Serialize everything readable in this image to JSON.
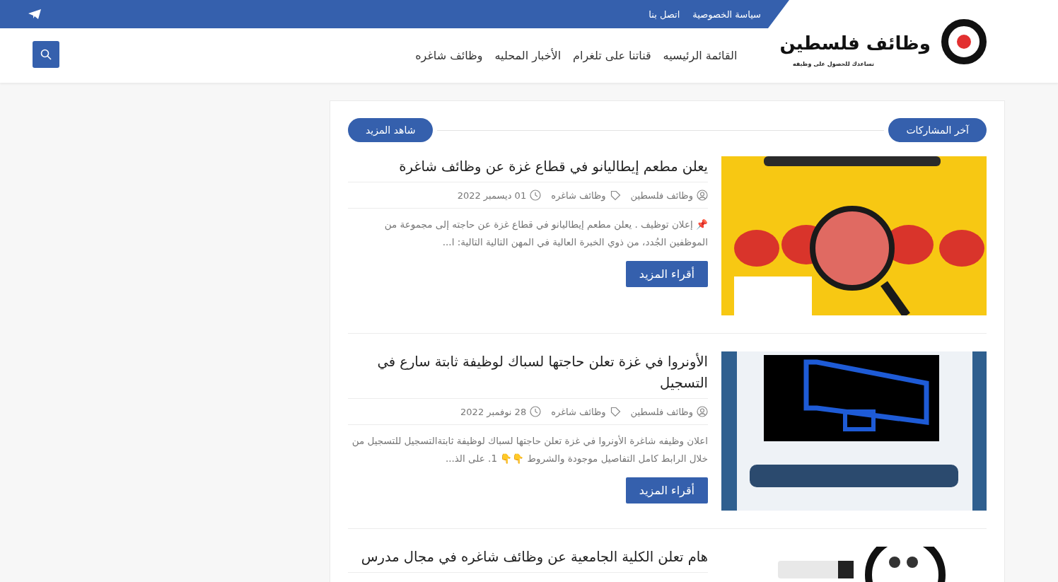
{
  "top_bar": {
    "links": [
      "سياسة الخصوصية",
      "اتصل بنا"
    ]
  },
  "logo": {
    "title": "وظائف فلسطين",
    "tagline": "تساعدك للحصول على وظيفه"
  },
  "nav": {
    "items": [
      "القائمة الرئيسيه",
      "قناتنا على تلغرام",
      "الأخبار المحليه",
      "وظائف شاغره"
    ]
  },
  "section": {
    "title": "آخر المشاركات",
    "more": "شاهد المزيد"
  },
  "posts": [
    {
      "title": "يعلن مطعم إيطاليانو في قطاع غزة عن وظائف شاغرة",
      "author": "وظائف فلسطين",
      "category": "وظائف شاغره",
      "date": "01 ديسمبر 2022",
      "excerpt": "📌 إعلان توظيف . يعلن مطعم إيطاليانو في قطاع غزة عن حاجته إلى مجموعة من الموظفين الجُدد، من ذوي الخبرة العالية في المهن التالية التالية:  ا...",
      "button": "أقراء المزيد"
    },
    {
      "title": "الأونروا في غزة تعلن حاجتها لسباك لوظيفة ثابتة سارع في التسجيل",
      "author": "وظائف فلسطين",
      "category": "وظائف شاغره",
      "date": "28 نوفمبر 2022",
      "excerpt": "اعلان وظيفه شاغرة الأونروا في غزة تعلن حاجتها لسباك لوظيفة ثابتةالتسجيل للتسجيل من خلال الرابط كامل التفاصيل موجودة والشروط 👇👇 1. على الذ...",
      "button": "أقراء المزيد"
    },
    {
      "title": "هام تعلن الكلية الجامعية عن وظائف شاغره في مجال مدرس"
    }
  ]
}
